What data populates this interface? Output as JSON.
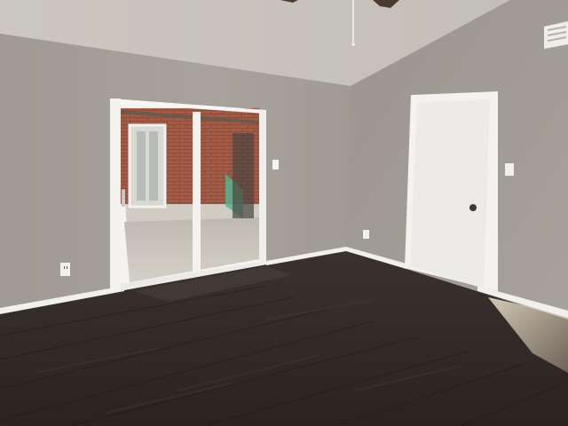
{
  "scene": {
    "colors": {
      "ceiling_left": "#cfcbc4",
      "ceiling_right": "#bdb8b1",
      "wall_back": "#a39e97",
      "wall_right": "#9d9891",
      "trim": "#f3f2ee",
      "floor_dark": "#2b2421",
      "floor_mid": "#3d3430",
      "door_panel": "#eeede9",
      "brick": "#a25a44",
      "patio": "#c9c5bd",
      "sunlight": "#e9dcc2"
    },
    "icons": {
      "ceiling_fan": "ceiling-fan-icon",
      "vent": "air-vent-icon",
      "outlet": "power-outlet-icon",
      "switch": "light-switch-icon",
      "knob": "door-knob-icon"
    }
  }
}
